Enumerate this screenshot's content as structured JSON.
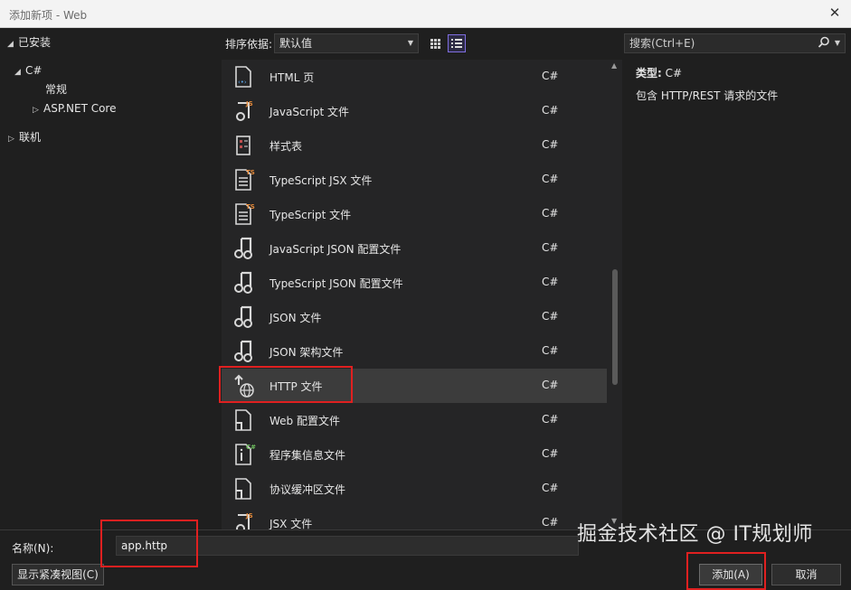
{
  "window": {
    "title": "添加新项 - Web",
    "close_glyph": "✕"
  },
  "tree": {
    "installed": "已安装",
    "csharp": "C#",
    "general": "常规",
    "aspnet": "ASP.NET Core",
    "online": "联机"
  },
  "toolbar": {
    "sort_label": "排序依据:",
    "sort_value": "默认值"
  },
  "items": [
    {
      "name": "HTML 页",
      "lang": "C#",
      "icon": "html-page-icon"
    },
    {
      "name": "JavaScript 文件",
      "lang": "C#",
      "icon": "javascript-file-icon"
    },
    {
      "name": "样式表",
      "lang": "C#",
      "icon": "stylesheet-icon"
    },
    {
      "name": "TypeScript JSX 文件",
      "lang": "C#",
      "icon": "typescript-jsx-file-icon"
    },
    {
      "name": "TypeScript 文件",
      "lang": "C#",
      "icon": "typescript-file-icon"
    },
    {
      "name": "JavaScript JSON 配置文件",
      "lang": "C#",
      "icon": "json-config-icon"
    },
    {
      "name": "TypeScript JSON 配置文件",
      "lang": "C#",
      "icon": "json-config-icon"
    },
    {
      "name": "JSON 文件",
      "lang": "C#",
      "icon": "json-file-icon"
    },
    {
      "name": "JSON 架构文件",
      "lang": "C#",
      "icon": "json-schema-icon"
    },
    {
      "name": "HTTP 文件",
      "lang": "C#",
      "icon": "http-file-icon"
    },
    {
      "name": "Web 配置文件",
      "lang": "C#",
      "icon": "web-config-icon"
    },
    {
      "name": "程序集信息文件",
      "lang": "C#",
      "icon": "assembly-info-icon"
    },
    {
      "name": "协议缓冲区文件",
      "lang": "C#",
      "icon": "protobuf-file-icon"
    },
    {
      "name": "JSX 文件",
      "lang": "C#",
      "icon": "jsx-file-icon"
    }
  ],
  "selected_index": 9,
  "search": {
    "placeholder": "搜索(Ctrl+E)"
  },
  "details": {
    "type_label": "类型:",
    "type_value": "C#",
    "description": "包含 HTTP/REST 请求的文件"
  },
  "bottom": {
    "name_label": "名称(N):",
    "name_value": "app.http",
    "compact_view": "显示紧凑视图(C)",
    "add": "添加(A)",
    "cancel": "取消"
  },
  "watermark": "掘金技术社区 @ IT规划师",
  "colors": {
    "highlight": "#e02020",
    "accent": "#7f6ee0"
  }
}
